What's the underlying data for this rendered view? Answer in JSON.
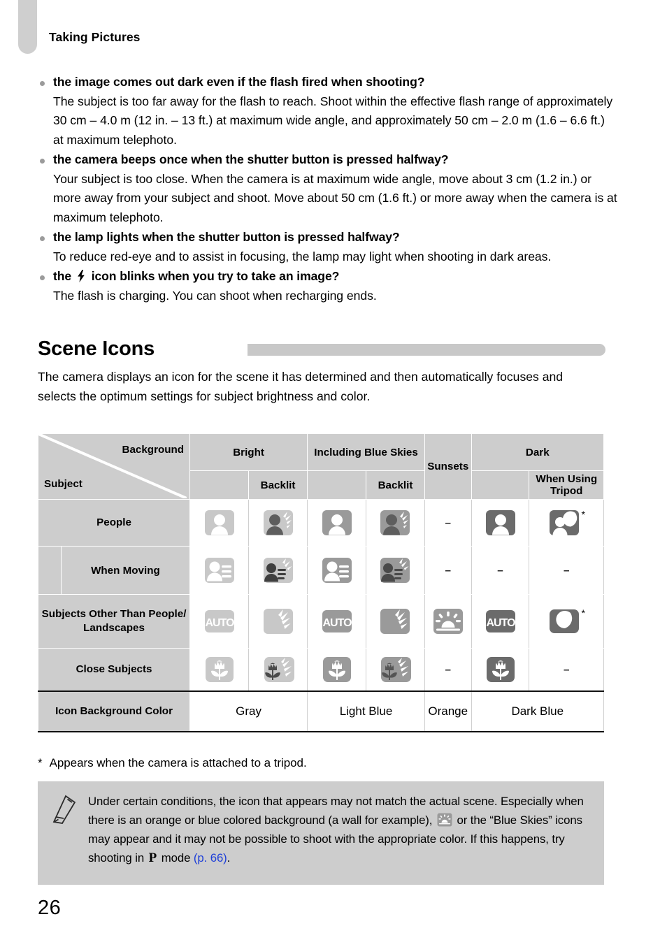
{
  "page": {
    "header": "Taking Pictures",
    "number": "26"
  },
  "bullets": [
    {
      "question": "the image comes out dark even if the flash fired when shooting?",
      "answer": "The subject is too far away for the flash to reach. Shoot within the effective flash range of approximately 30 cm – 4.0 m (12 in. – 13 ft.) at maximum wide angle, and approximately 50 cm – 2.0 m (1.6 – 6.6 ft.) at maximum telephoto."
    },
    {
      "question": "the camera beeps once when the shutter button is pressed halfway?",
      "answer": "Your subject is too close. When the camera is at maximum wide angle, move about 3 cm (1.2 in.) or more away from your subject and shoot. Move about 50 cm (1.6 ft.) or more away when the camera is at maximum telephoto."
    },
    {
      "question": "the lamp lights when the shutter button is pressed halfway?",
      "answer": "To reduce red-eye and to assist in focusing, the lamp may light when shooting in dark areas."
    },
    {
      "question_prefix": "the",
      "question_icon": "flash-icon",
      "question_suffix": "icon blinks when you try to take an image?",
      "answer": "The flash is charging. You can shoot when recharging ends."
    }
  ],
  "section": {
    "title": "Scene Icons",
    "intro": "The camera displays an icon for the scene it has determined and then automatically focuses and selects the optimum settings for subject brightness and color."
  },
  "table": {
    "corner": {
      "background_label": "Background",
      "subject_label": "Subject"
    },
    "columns": [
      {
        "label": "Bright",
        "sub": ""
      },
      {
        "label": "",
        "sub": "Backlit"
      },
      {
        "label": "Including Blue Skies",
        "sub": ""
      },
      {
        "label": "",
        "sub": "Backlit"
      },
      {
        "label": "Sunsets",
        "sub": ""
      },
      {
        "label": "Dark",
        "sub": ""
      },
      {
        "label": "",
        "sub": "When Using Tripod"
      }
    ],
    "group_headers": {
      "bright": "Bright",
      "backlit": "Backlit",
      "blue_skies": "Including Blue Skies",
      "sunsets": "Sunsets",
      "dark": "Dark",
      "tripod": "When Using Tripod"
    },
    "rows": [
      {
        "label": "People",
        "cells": [
          {
            "icon": "person-icon",
            "tone": "light"
          },
          {
            "icon": "person-backlit-icon",
            "tone": "light"
          },
          {
            "icon": "person-icon",
            "tone": "mid"
          },
          {
            "icon": "person-backlit-icon",
            "tone": "mid"
          },
          {
            "icon": "dash"
          },
          {
            "icon": "person-icon",
            "tone": "dark"
          },
          {
            "icon": "person-moon-icon",
            "tone": "dark",
            "star": "*"
          }
        ]
      },
      {
        "label": "When Moving",
        "indent": true,
        "cells": [
          {
            "icon": "person-moving-icon",
            "tone": "light"
          },
          {
            "icon": "person-moving-backlit-icon",
            "tone": "light"
          },
          {
            "icon": "person-moving-icon",
            "tone": "mid"
          },
          {
            "icon": "person-moving-backlit-icon",
            "tone": "mid"
          },
          {
            "icon": "dash"
          },
          {
            "icon": "dash"
          },
          {
            "icon": "dash"
          }
        ]
      },
      {
        "label": "Subjects Other Than People/ Landscapes",
        "cells": [
          {
            "icon": "auto-icon",
            "tone": "light"
          },
          {
            "icon": "backlit-icon",
            "tone": "light"
          },
          {
            "icon": "auto-icon",
            "tone": "mid"
          },
          {
            "icon": "backlit-icon",
            "tone": "mid"
          },
          {
            "icon": "sunset-icon",
            "tone": "mid"
          },
          {
            "icon": "auto-icon",
            "tone": "dark"
          },
          {
            "icon": "moon-icon",
            "tone": "dark",
            "star": "*"
          }
        ]
      },
      {
        "label": "Close Subjects",
        "cells": [
          {
            "icon": "flower-icon",
            "tone": "light"
          },
          {
            "icon": "flower-backlit-icon",
            "tone": "light"
          },
          {
            "icon": "flower-icon",
            "tone": "mid"
          },
          {
            "icon": "flower-backlit-icon",
            "tone": "mid"
          },
          {
            "icon": "dash"
          },
          {
            "icon": "flower-icon",
            "tone": "dark"
          },
          {
            "icon": "dash"
          }
        ]
      }
    ],
    "color_row": {
      "label": "Icon Background Color",
      "values": [
        "Gray",
        "Light Blue",
        "Orange",
        "Dark Blue"
      ]
    }
  },
  "footnote": {
    "marker": "*",
    "text": "Appears when the camera is attached to a tripod."
  },
  "note": {
    "part1": "Under certain conditions, the icon that appears may not match the actual scene. Especially when there is an orange or blue colored background (a wall for example),",
    "part2": "or the “Blue Skies” icons may appear and it may not be possible to shoot with the appropriate color. If this happens, try shooting in",
    "mode": "P",
    "part3": "mode",
    "link": "(p. 66)",
    "period": "."
  },
  "colors": {
    "tab_gray": "#cfcfcf",
    "header_gray": "#cdcdcd",
    "icon_light": "#c8c8c8",
    "icon_mid": "#9a9a9a",
    "icon_dark": "#6b6b6b",
    "link_blue": "#1e3fd8"
  }
}
